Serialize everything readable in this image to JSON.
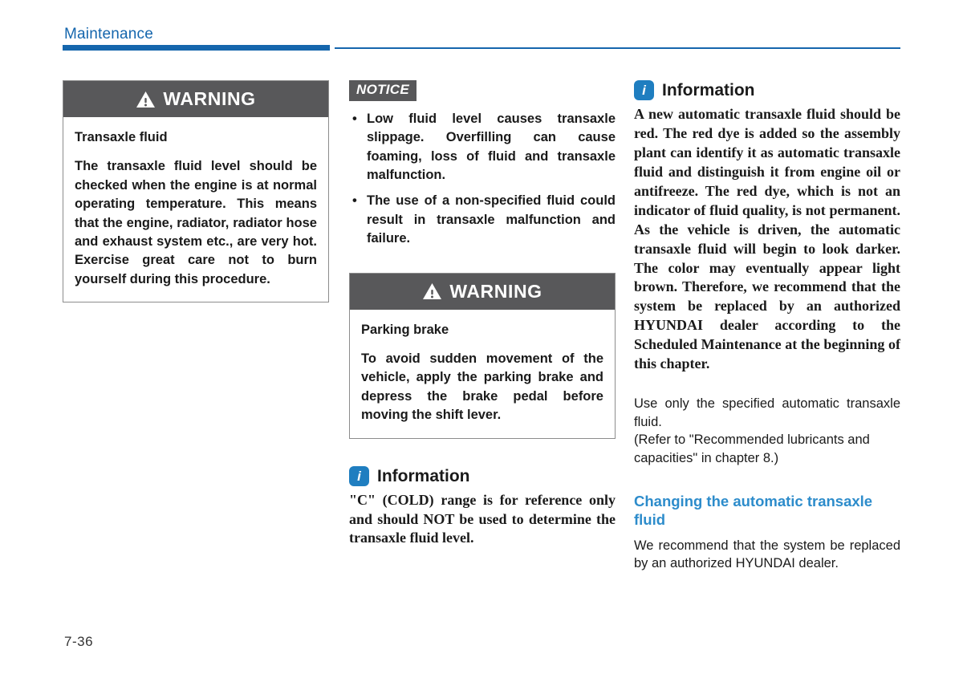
{
  "header": {
    "chapter_title": "Maintenance",
    "rule_color": "#1566ad"
  },
  "footer": {
    "page_number": "7-36"
  },
  "column_1": {
    "warning": {
      "icon_name": "warning-triangle-icon",
      "title": "WARNING",
      "subtitle": "Transaxle fluid",
      "body": "The transaxle fluid level should be checked when the engine is at normal operating temperature. This means that the engine, radiator, radiator hose and exhaust system etc., are very hot. Exercise great care not to burn yourself during this procedure."
    }
  },
  "column_2": {
    "notice": {
      "badge_label": "NOTICE",
      "items": [
        "Low fluid level causes transaxle slippage. Overfilling can cause foaming, loss of fluid and transaxle malfunction.",
        "The use of a non-specified fluid could result in transaxle malfunction and failure."
      ],
      "bullet_glyph": "•"
    },
    "warning": {
      "icon_name": "warning-triangle-icon",
      "title": "WARNING",
      "subtitle": "Parking brake",
      "body": "To avoid sudden movement of the vehicle, apply the parking brake and depress the brake pedal before moving the shift lever."
    },
    "information": {
      "icon_letter": "i",
      "title": "Information",
      "body": "\"C\" (COLD) range is for reference only and should NOT be used to determine the transaxle fluid level."
    }
  },
  "column_3": {
    "information": {
      "icon_letter": "i",
      "title": "Information",
      "body": "A new automatic transaxle fluid should be red. The red dye is added so the assembly plant can identify it as automatic transaxle fluid and distinguish it from engine oil or antifreeze. The red dye, which is not an indicator of fluid quality, is not permanent. As the vehicle is driven, the automatic transaxle fluid will begin to look darker. The color may eventually appear light brown. Therefore, we recommend that the system be replaced by an authorized HYUNDAI dealer according to the Scheduled Maintenance at the beginning of this chapter."
    },
    "paragraph_1": "Use only the specified automatic transaxle fluid.",
    "paragraph_2": "(Refer to \"Recommended lubricants and capacities\" in chapter 8.)",
    "sub_heading": "Changing the automatic transaxle fluid",
    "paragraph_3": "We recommend that the system be replaced by an authorized HYUNDAI dealer."
  },
  "colors": {
    "accent_blue": "#1566ad",
    "heading_blue": "#2d8ccb",
    "info_icon_blue": "#1f7ec0",
    "warning_gray": "#58585a"
  }
}
